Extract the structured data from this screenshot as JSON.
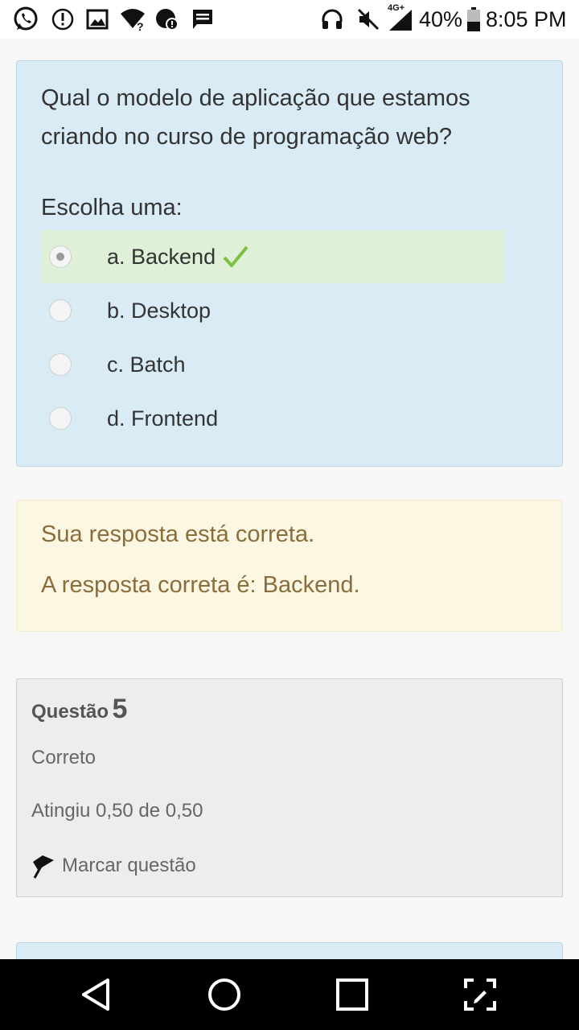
{
  "status_bar": {
    "network": "4G+",
    "battery": "40%",
    "time": "8:05 PM"
  },
  "question": {
    "text": "Qual o modelo de aplicação que estamos criando no curso de programação web?",
    "prompt": "Escolha uma:",
    "answers": [
      {
        "label": "a. Backend",
        "selected": true,
        "correct": true
      },
      {
        "label": "b. Desktop",
        "selected": false,
        "correct": false
      },
      {
        "label": "c. Batch",
        "selected": false,
        "correct": false
      },
      {
        "label": "d. Frontend",
        "selected": false,
        "correct": false
      }
    ]
  },
  "feedback": {
    "line1": "Sua resposta está correta.",
    "line2": "A resposta correta é: Backend."
  },
  "info": {
    "title_word": "Questão",
    "number": "5",
    "status": "Correto",
    "score": "Atingiu 0,50 de 0,50",
    "flag_label": "Marcar questão"
  },
  "colors": {
    "question_bg": "#d9ecf6",
    "correct_bg": "#dff0d8",
    "feedback_bg": "#fcf7e3",
    "feedback_text": "#8a6d3b",
    "check": "#7cc242"
  },
  "icons": [
    "whatsapp-icon",
    "alert-icon",
    "image-icon",
    "wifi-unknown-icon",
    "data-saver-icon",
    "message-icon",
    "headset-icon",
    "mute-icon",
    "signal-icon",
    "battery-icon",
    "back-icon",
    "home-icon",
    "recents-icon",
    "fullscreen-icon"
  ]
}
